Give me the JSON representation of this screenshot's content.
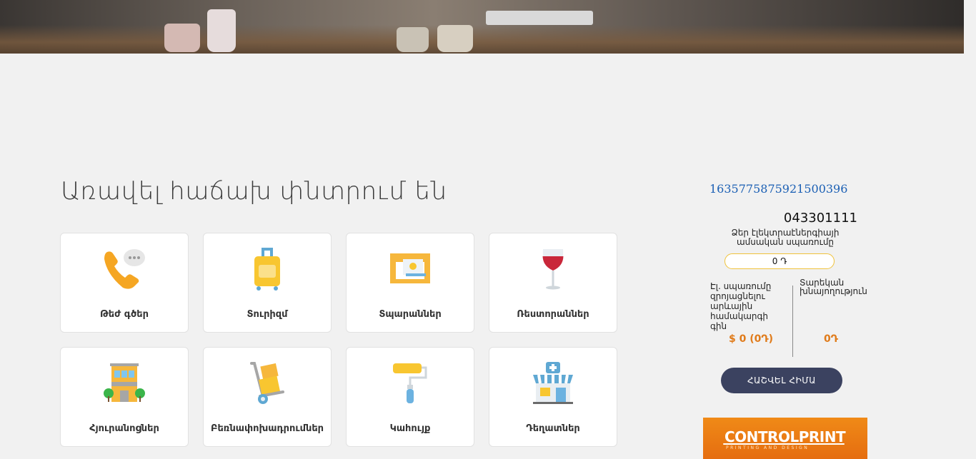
{
  "section": {
    "title": "Առավել հաճախ փնտրում են"
  },
  "categories": [
    {
      "label": "Թեժ գծեր",
      "icon": "phone-chat-icon"
    },
    {
      "label": "Տուրիզմ",
      "icon": "suitcase-icon"
    },
    {
      "label": "Տպարաններ",
      "icon": "printer-icon"
    },
    {
      "label": "Ռեստորաններ",
      "icon": "wine-glass-icon"
    },
    {
      "label": "Հյուրանոցներ",
      "icon": "hotel-icon"
    },
    {
      "label": "Բեռնափոխադրումներ",
      "icon": "hand-truck-icon"
    },
    {
      "label": "Կահույք",
      "icon": "paint-roller-icon"
    },
    {
      "label": "Դեղատներ",
      "icon": "pharmacy-icon"
    }
  ],
  "sidebar": {
    "id_number": "1635775875921500396",
    "account_number": "043301111",
    "account_desc": "Ձեր էլեկտրաէներգիայի ամսական սպառումը",
    "consumption_value": "0 Դ",
    "left_label": "Էլ. սպառումը զրոյացնելու արևային համակարգի գին",
    "right_label": "Տարեկան խնայողություն",
    "left_value": "$ 0 (0Դ)",
    "right_value": "0Դ",
    "calc_button": "ՀԱՇՎԵԼ ՀԻՄԱ"
  },
  "banner": {
    "logo_text": "CONTROLPRINT",
    "tagline": "PRINTING AND DESIGN"
  },
  "colors": {
    "accent": "#e07b1a",
    "button": "#3b4260",
    "link": "#1a5fb4",
    "pill_border": "#f0c23a"
  }
}
